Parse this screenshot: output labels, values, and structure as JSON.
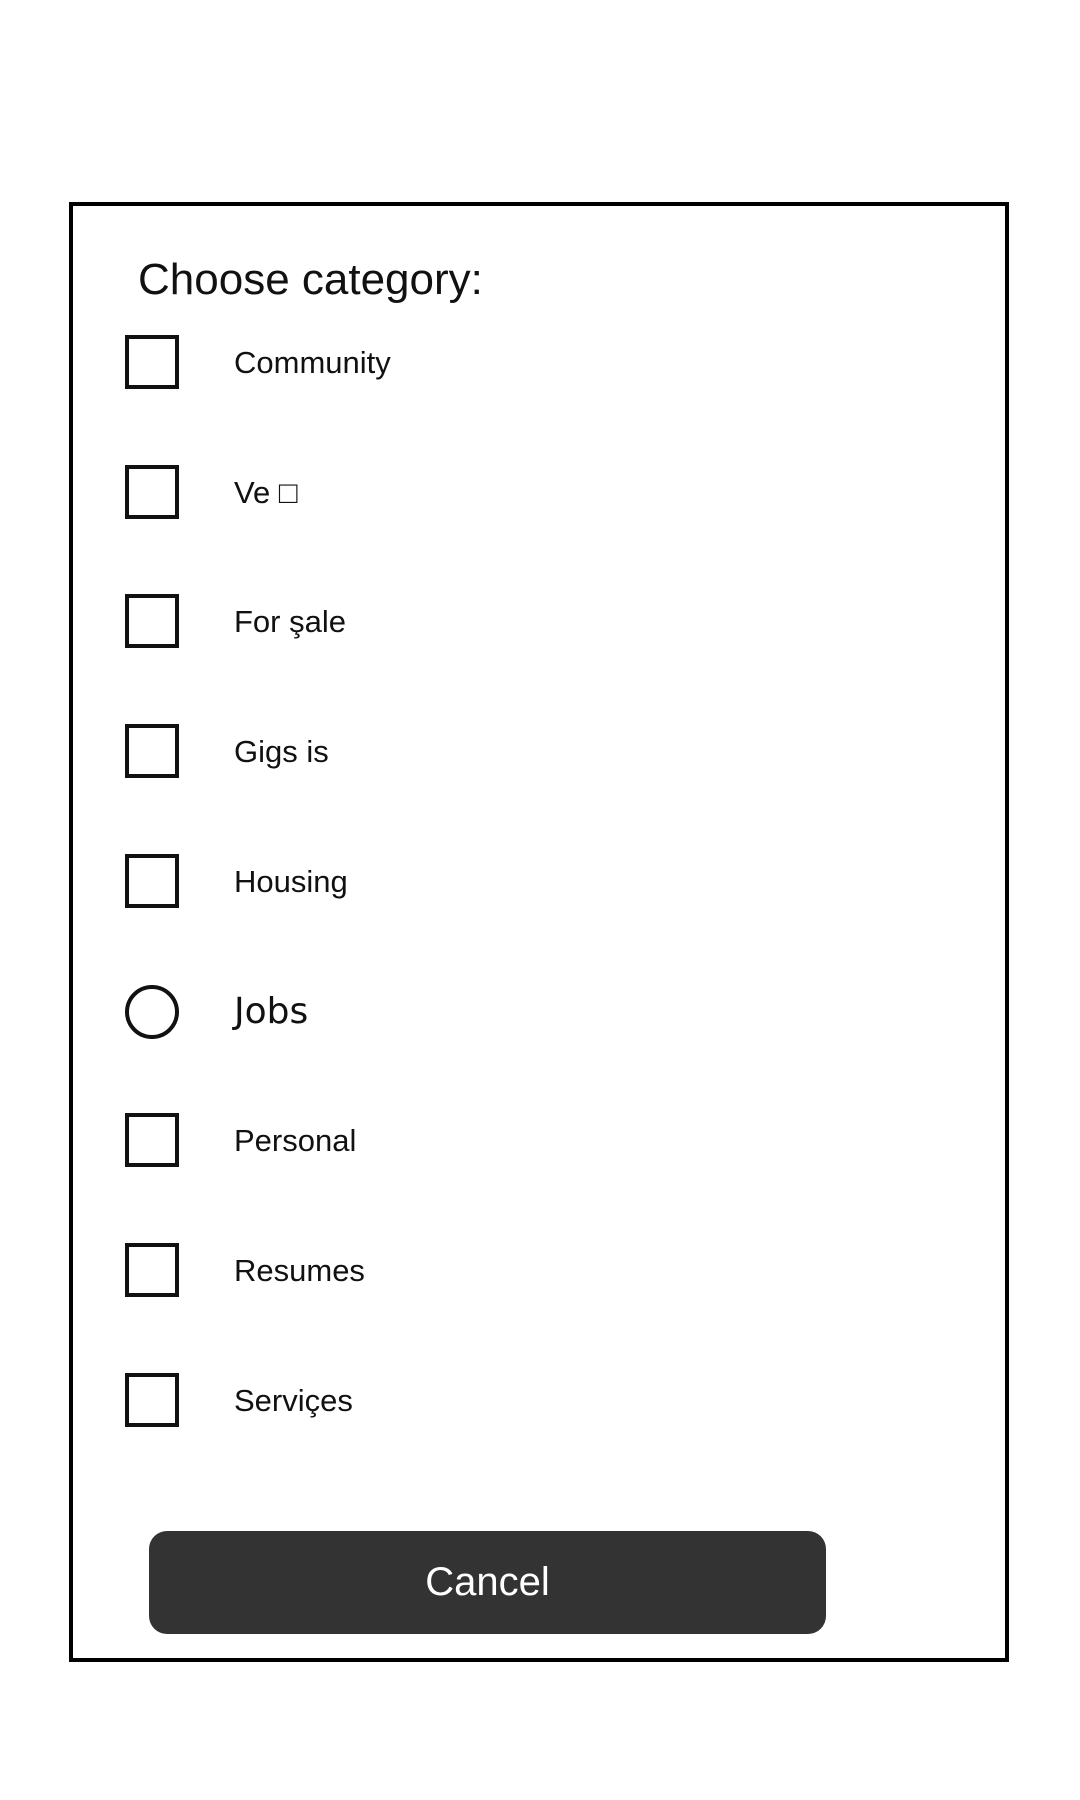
{
  "dialog": {
    "title": "Choose category:",
    "options": [
      {
        "label": "Community",
        "control": "checkbox",
        "checked": false
      },
      {
        "label": "Ve □",
        "control": "checkbox",
        "checked": false
      },
      {
        "label": "For şale",
        "control": "checkbox",
        "checked": false
      },
      {
        "label": "Gigs is",
        "control": "checkbox",
        "checked": false
      },
      {
        "label": "Housing",
        "control": "checkbox",
        "checked": false
      },
      {
        "label": "Jobs",
        "control": "radio",
        "checked": false
      },
      {
        "label": "Personal",
        "control": "checkbox",
        "checked": false
      },
      {
        "label": "Resumes",
        "control": "checkbox",
        "checked": false
      },
      {
        "label": "Serviçes",
        "control": "checkbox",
        "checked": false
      }
    ],
    "cancel_label": "Cancel"
  },
  "colors": {
    "border": "#000000",
    "button_bg": "#333333",
    "button_text": "#ffffff",
    "text": "#111111"
  }
}
